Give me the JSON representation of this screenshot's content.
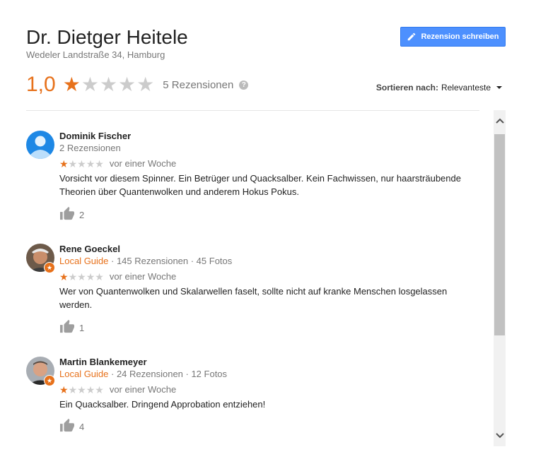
{
  "header": {
    "title": "Dr. Dietger Heitele",
    "address": "Wedeler Landstraße 34, Hamburg",
    "write_review_label": "Rezension schreiben"
  },
  "summary": {
    "average": "1,0",
    "average_value": 1,
    "max_stars": 5,
    "review_count": "5 Rezensionen",
    "help_glyph": "?"
  },
  "sort": {
    "label": "Sortieren nach:",
    "value": "Relevanteste"
  },
  "reviews": [
    {
      "name": "Dominik Fischer",
      "local_guide": "",
      "meta": "2 Rezensionen",
      "stars": 1,
      "time": "vor einer Woche",
      "text": "Vorsicht vor diesem Spinner. Ein Betrüger und Quacksalber. Kein Fachwissen, nur haarsträubende Theorien über Quantenwolken und anderem Hokus Pokus.",
      "likes": "2"
    },
    {
      "name": "Rene Goeckel",
      "local_guide": "Local Guide",
      "meta": " · 145 Rezensionen · 45 Fotos",
      "stars": 1,
      "time": "vor einer Woche",
      "text": "Wer von Quantenwolken und Skalarwellen faselt, sollte nicht auf kranke Menschen losgelassen werden.",
      "likes": "1"
    },
    {
      "name": "Martin Blankemeyer",
      "local_guide": "Local Guide",
      "meta": " · 24 Rezensionen · 12 Fotos",
      "stars": 1,
      "time": "vor einer Woche",
      "text": "Ein Quacksalber. Dringend Approbation entziehen!",
      "likes": "4"
    }
  ],
  "colors": {
    "accent_orange": "#e7711b",
    "button_blue": "#4d90fe",
    "star_empty": "#cccccc"
  },
  "icons": {
    "pencil": "pencil-icon",
    "thumbs_up": "thumbs-up-icon",
    "help": "help-icon",
    "scroll_up": "chevron-up-icon",
    "scroll_down": "chevron-down-icon"
  }
}
